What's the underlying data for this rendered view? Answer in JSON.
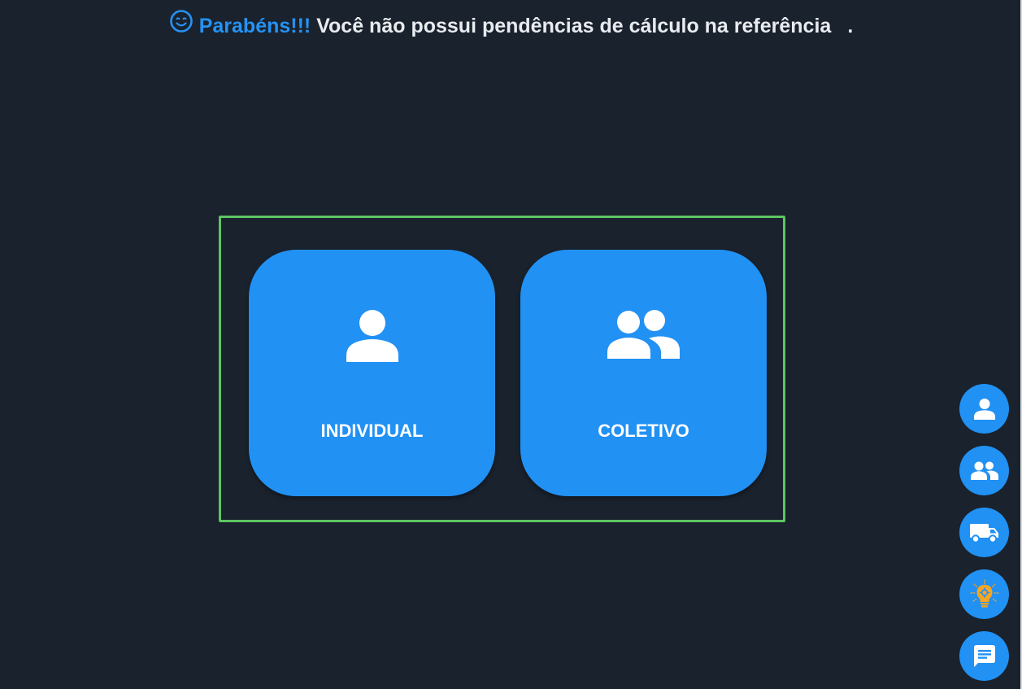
{
  "banner": {
    "icon": "smile-icon",
    "congrats": "Parabéns!!!",
    "message": " Você não possui pendências de cálculo na referência",
    "reference": "",
    "period": "."
  },
  "options": [
    {
      "label": "INDIVIDUAL",
      "icon": "person-icon"
    },
    {
      "label": "COLETIVO",
      "icon": "group-icon"
    }
  ],
  "side_actions": [
    {
      "icon": "person-icon"
    },
    {
      "icon": "group-icon"
    },
    {
      "icon": "truck-icon"
    },
    {
      "icon": "lightbulb-icon"
    },
    {
      "icon": "chat-icon"
    }
  ],
  "colors": {
    "background": "#1a222d",
    "accent": "#2191f4",
    "selection_frame": "#5ec464",
    "bulb": "#f5a623"
  }
}
